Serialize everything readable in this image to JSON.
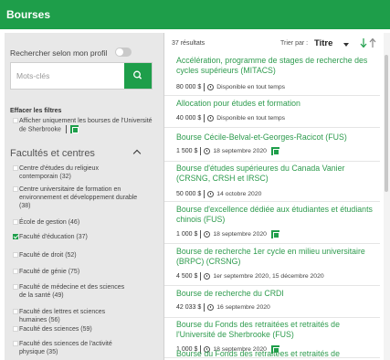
{
  "header": {
    "title": "Bourses"
  },
  "sidebar": {
    "profile_label": "Rechercher selon mon profil",
    "search": {
      "placeholder": "Mots-clés",
      "value": ""
    },
    "clear_filters": "Effacer les filtres",
    "sherbrooke_only_label": "Afficher uniquement les bourses de l'Université de Sherbrooke",
    "section_title": "Facultés et centres",
    "options": [
      {
        "label": "Centre d'études du religieux contemporain (32)",
        "checked": false
      },
      {
        "label": "Centre universitaire de formation en environnement et développement durable (38)",
        "checked": false
      },
      {
        "label": "École de gestion (46)",
        "checked": false
      },
      {
        "label": "Faculté d'éducation (37)",
        "checked": true
      },
      {
        "label": "Faculté de droit (52)",
        "checked": false
      },
      {
        "label": "Faculté de génie (75)",
        "checked": false
      },
      {
        "label": "Faculté de médecine et des sciences de la santé (49)",
        "checked": false
      },
      {
        "label": "Faculté des lettres et sciences humaines (56)",
        "checked": false
      },
      {
        "label": "Faculté des sciences (59)",
        "checked": false
      },
      {
        "label": "Faculté des sciences de l'activité physique (35)",
        "checked": false
      }
    ]
  },
  "results": {
    "count": "37 résultats",
    "sort_label": "Trier par :",
    "sort_value": "Titre",
    "items": [
      {
        "title": "Accélération, programme de stages de recherche des cycles supérieurs (MITACS)",
        "amount": "80 000 $",
        "date": "Disponible en tout temps",
        "badge": false
      },
      {
        "title": "Allocation pour études et formation",
        "amount": "40 000 $",
        "date": "Disponible en tout temps",
        "badge": false
      },
      {
        "title": "Bourse Cécile-Belval-et-Georges-Racicot (FUS)",
        "amount": "1 500 $",
        "date": "18 septembre 2020",
        "badge": true
      },
      {
        "title": "Bourse d'études supérieures du Canada Vanier (CRSNG, CRSH et IRSC)",
        "amount": "50 000 $",
        "date": "14 octobre 2020",
        "badge": false
      },
      {
        "title": "Bourse d'excellence dédiée aux étudiantes et étudiants chinois (FUS)",
        "amount": "1 000 $",
        "date": "18 septembre 2020",
        "badge": true
      },
      {
        "title": "Bourse de recherche 1er cycle en milieu universitaire (BRPC) (CRSNG)",
        "amount": "4 500 $",
        "date": "1er septembre 2020, 15 décembre 2020",
        "badge": false
      },
      {
        "title": "Bourse de recherche du CRDI",
        "amount": "42 033 $",
        "date": "16 septembre 2020",
        "badge": false
      },
      {
        "title": "Bourse du Fonds des retraitées et retraités de l'Université de Sherbrooke (FUS)",
        "amount": "1 000 $",
        "date": "18 septembre 2020",
        "badge": true
      },
      {
        "title": "Bourse du Fonds des retraitées et retraités de l'Université",
        "amount": "",
        "date": "",
        "badge": false
      }
    ]
  },
  "colors": {
    "brand": "#1e9e4a",
    "link": "#2e9b4e",
    "sidebar_bg": "#e8e8e8"
  },
  "icons": {
    "search": "search-icon",
    "sort_down": "arrow-down-icon",
    "sort_up": "arrow-up-icon",
    "clock": "clock-icon",
    "badge": "us-badge-icon",
    "collapse": "chevron-up-icon"
  }
}
